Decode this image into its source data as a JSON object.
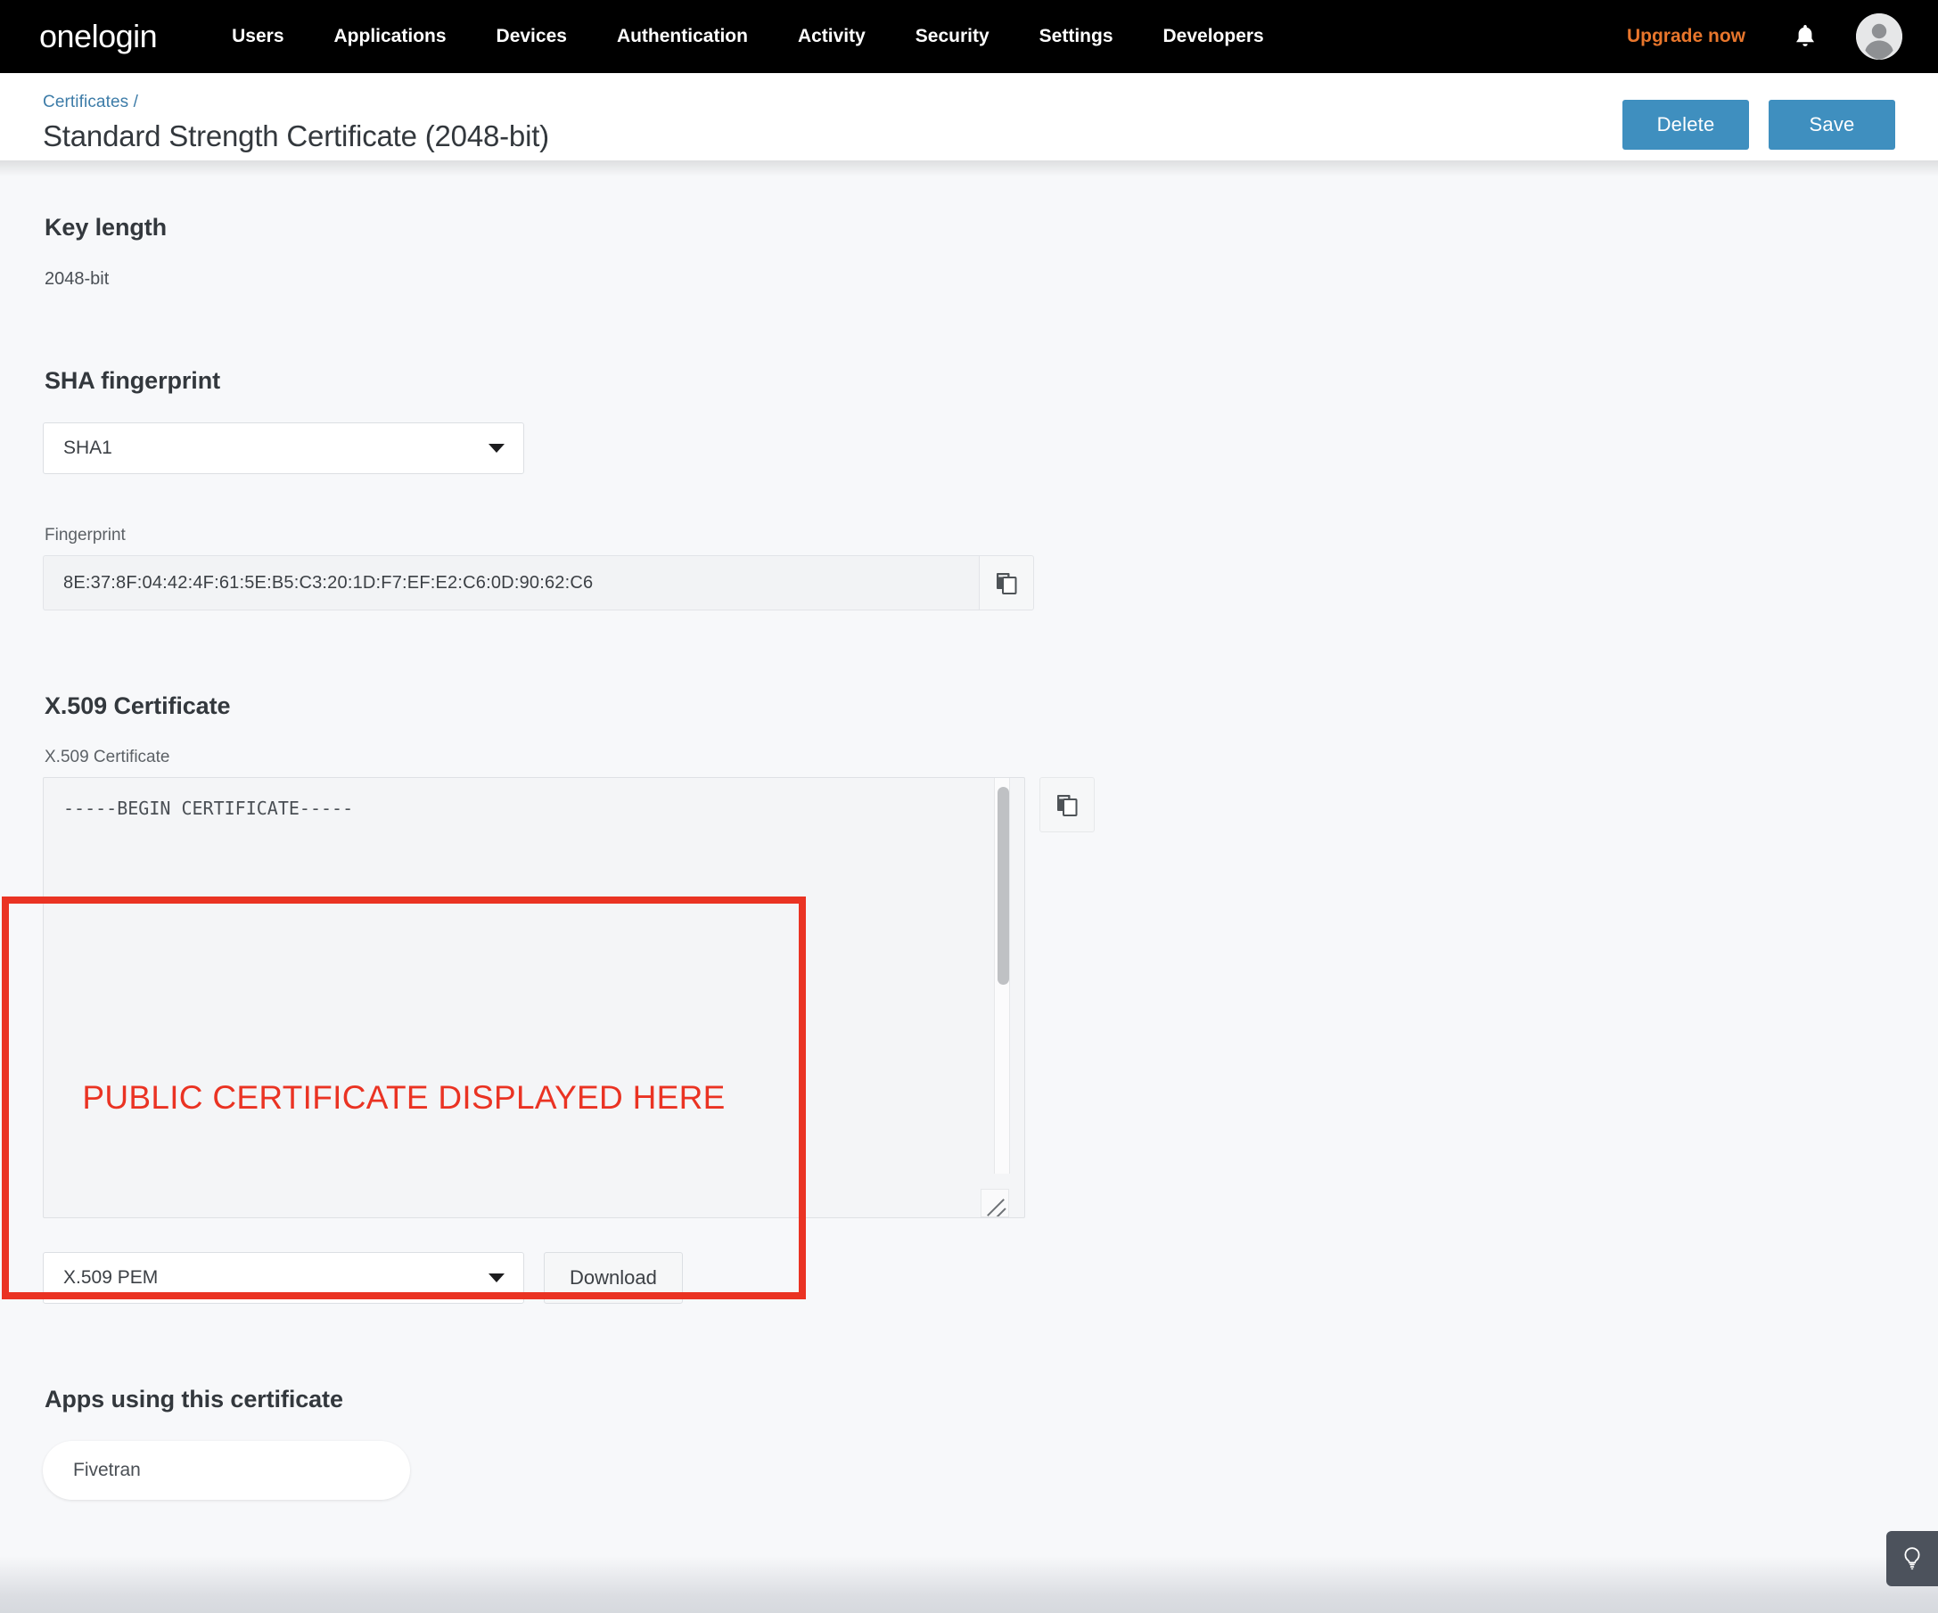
{
  "nav": {
    "brand": "onelogin",
    "items": [
      {
        "label": "Users"
      },
      {
        "label": "Applications"
      },
      {
        "label": "Devices"
      },
      {
        "label": "Authentication"
      },
      {
        "label": "Activity"
      },
      {
        "label": "Security"
      },
      {
        "label": "Settings"
      },
      {
        "label": "Developers"
      }
    ],
    "upgrade_label": "Upgrade now",
    "upgrade_color": "#e8762c",
    "bell_icon": "bell-icon",
    "avatar_icon": "user-avatar-icon"
  },
  "header": {
    "breadcrumb": "Certificates /",
    "title": "Standard Strength Certificate (2048-bit)",
    "delete_label": "Delete",
    "save_label": "Save",
    "button_color": "#3f8fbf",
    "breadcrumb_color": "#3d7ca8"
  },
  "key_length": {
    "section_title": "Key length",
    "value": "2048-bit"
  },
  "sha_fingerprint": {
    "section_title": "SHA fingerprint",
    "algorithm_selected": "SHA1",
    "fingerprint_label": "Fingerprint",
    "fingerprint_value": "8E:37:8F:04:42:4F:61:5E:B5:C3:20:1D:F7:EF:E2:C6:0D:90:62:C6",
    "copy_icon": "copy-icon"
  },
  "x509": {
    "section_title": "X.509 Certificate",
    "field_label": "X.509 Certificate",
    "textarea_value": "-----BEGIN CERTIFICATE-----",
    "copy_icon": "copy-icon",
    "format_selected": "X.509 PEM",
    "download_label": "Download",
    "resize_handle": "resize-grip-icon",
    "scrollbar": "vertical-scrollbar"
  },
  "annotation": {
    "text": "PUBLIC CERTIFICATE DISPLAYED HERE",
    "color": "#ea3323"
  },
  "apps": {
    "section_title": "Apps using this certificate",
    "items": [
      {
        "label": "Fivetran"
      }
    ]
  },
  "help": {
    "icon": "lightbulb-icon"
  }
}
